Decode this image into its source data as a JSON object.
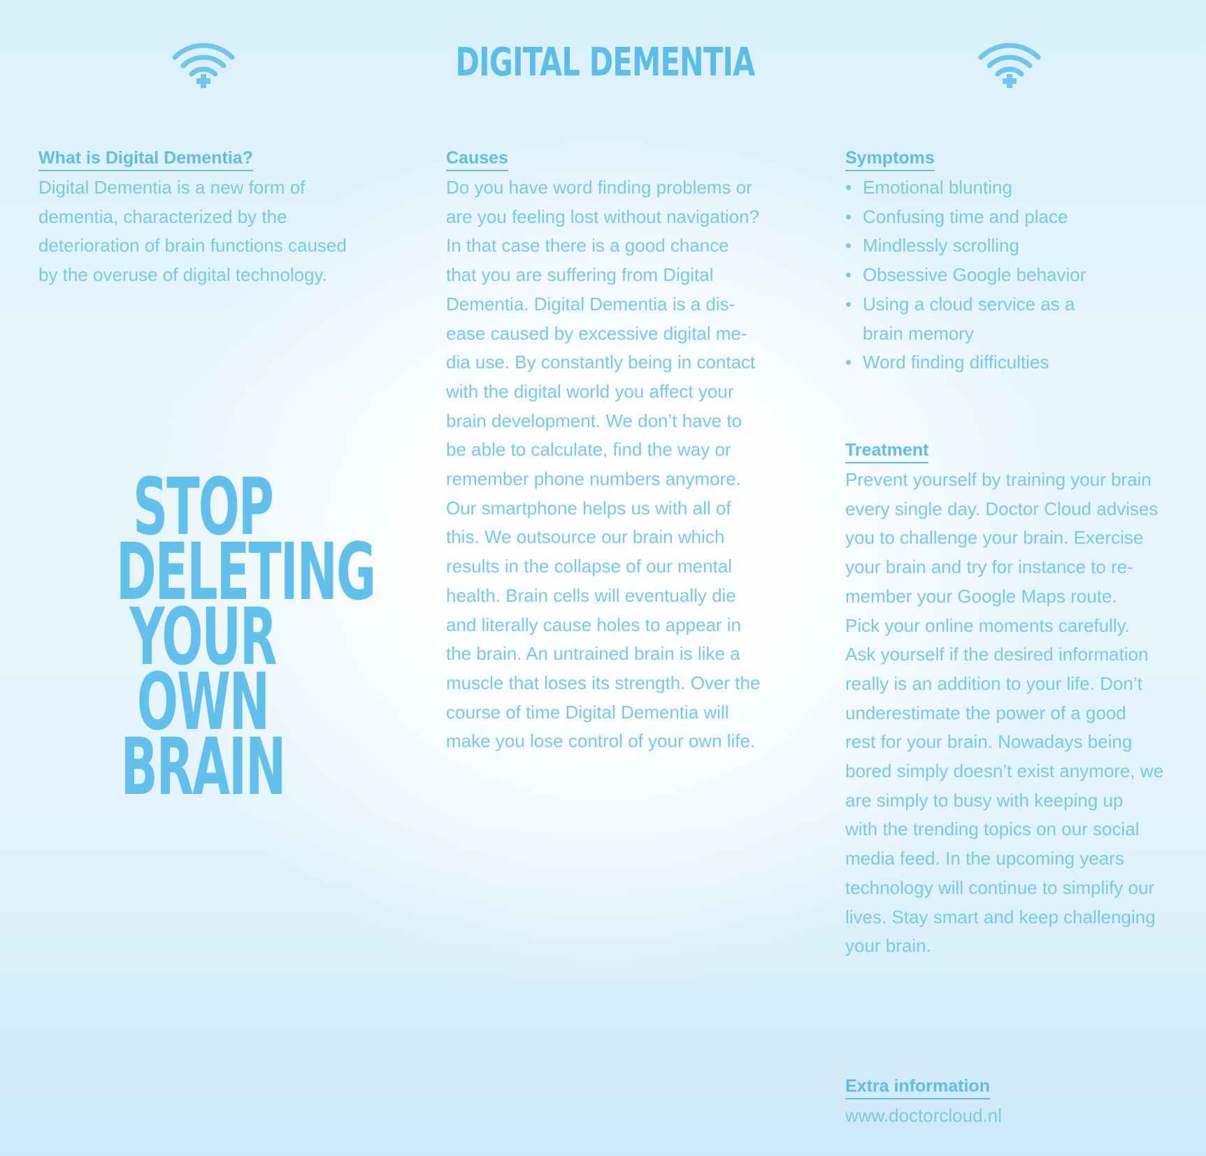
{
  "header": {
    "title": "DIGITAL DEMENTIA",
    "left_icon": "wifi-plus-icon",
    "right_icon": "wifi-plus-icon"
  },
  "what_is": {
    "heading": "What is Digital Dementia?",
    "text": "Digital Dementia is a new form of\ndementia, characterized by the\ndeterioration of brain functions caused\nby the overuse of digital technology."
  },
  "slogan": {
    "lines": [
      "STOP",
      "DELETING",
      "YOUR",
      "OWN",
      "BRAIN"
    ]
  },
  "causes": {
    "heading": "Causes",
    "text": "Do you have word finding problems or\nare you feeling lost without navigation?\nIn that case there is a good chance\nthat you are suffering from Digital\nDementia. Digital Dementia is a dis-\nease caused by excessive digital me-\ndia use. By constantly being in contact\nwith the digital world you affect your\nbrain development. We don’t have to\nbe able to calculate, find the way or\nremember phone numbers anymore.\nOur smartphone helps us with all of\nthis. We outsource our brain which\nresults in the collapse of our mental\nhealth. Brain cells will eventually die\nand literally cause holes to appear in\nthe brain. An untrained brain is like a\nmuscle that loses its strength. Over the\ncourse of time Digital Dementia will\nmake you lose control of your own life."
  },
  "symptoms": {
    "heading": "Symptoms",
    "items": [
      "Emotional blunting",
      "Confusing time and place",
      "Mindlessly scrolling",
      "Obsessive Google behavior",
      "Using a cloud service as a\nbrain memory",
      "Word finding difficulties"
    ]
  },
  "treatment": {
    "heading": "Treatment",
    "text": "Prevent yourself by training your brain\nevery single day. Doctor Cloud advises\nyou to challenge your brain. Exercise\nyour brain and try for instance to re-\nmember your Google Maps route.\nPick your online moments carefully.\nAsk yourself if the desired information\nreally is an addition to your life. Don’t\nunderestimate the power of a good\nrest for your brain. Nowadays being\nbored simply doesn’t exist anymore, we\nare simply to busy with keeping up\nwith the trending topics on our social\nmedia feed. In the upcoming years\ntechnology will continue to simplify our\nlives. Stay smart and keep challenging\nyour brain."
  },
  "extra": {
    "heading": "Extra information",
    "url": "www.doctorcloud.nl"
  },
  "colors": {
    "accent": "#5fbde9",
    "body_text": "#77c8ef",
    "background_top": "#d9f0fb",
    "background_center": "#ffffff"
  }
}
